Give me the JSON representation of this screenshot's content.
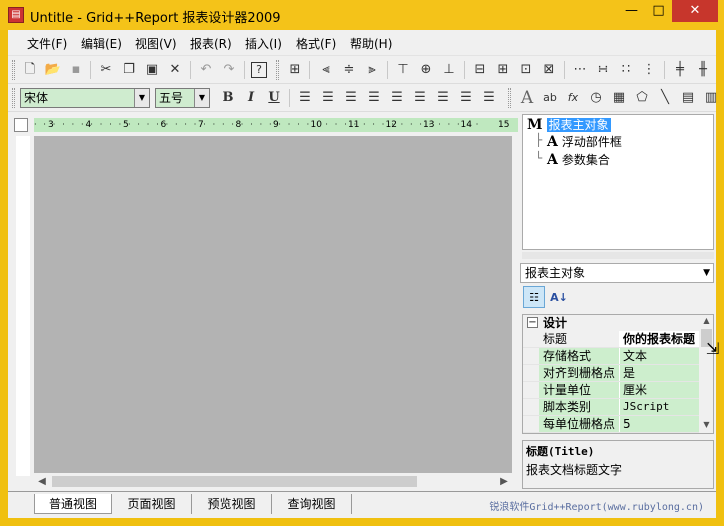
{
  "window": {
    "title": "Untitle - Grid++Report 报表设计器2009",
    "app_icon": "report-designer-icon",
    "minimize": "—",
    "maximize": "□",
    "close": "✕"
  },
  "menu": [
    "文件(F)",
    "编辑(E)",
    "视图(V)",
    "报表(R)",
    "插入(I)",
    "格式(F)",
    "帮助(H)"
  ],
  "toolbar1": {
    "icons": [
      "new-file-icon",
      "open-folder-icon",
      "save-icon",
      "cut-icon",
      "copy-icon",
      "paste-icon",
      "delete-icon",
      "undo-icon",
      "redo-icon",
      "help-icon",
      "grid-icon",
      "align-left-icon",
      "align-center-icon",
      "align-right-icon",
      "align-top-icon",
      "align-middle-icon",
      "align-bottom-icon",
      "same-width-icon",
      "same-height-icon",
      "same-size-icon",
      "space-horizontal-icon",
      "space-equal-icon",
      "space-decrease-icon",
      "space-remove-icon",
      "center-horizontal-icon",
      "center-vertical-icon"
    ]
  },
  "toolbar2": {
    "font_name": "宋体",
    "font_size": "五号",
    "bold": "B",
    "italic": "I",
    "underline": "U",
    "insert_icons": [
      "static-text-icon",
      "field-box-icon",
      "formula-icon",
      "system-var-icon",
      "memo-icon",
      "shape-icon",
      "line-icon",
      "picture-icon",
      "barcode-icon"
    ]
  },
  "ruler": {
    "marks": [
      "3",
      "4",
      "5",
      "6",
      "7",
      "8",
      "9",
      "10",
      "11",
      "12",
      "13",
      "14",
      "15"
    ]
  },
  "view_tabs": [
    "普通视图",
    "页面视图",
    "预览视图",
    "查询视图"
  ],
  "brand": "锐浪软件Grid++Report(www.rubylong.cn)",
  "tree": {
    "root": "报表主对象",
    "root_glyph": "M",
    "children": [
      {
        "glyph": "A",
        "label": "浮动部件框"
      },
      {
        "glyph": "A",
        "label": "参数集合"
      }
    ]
  },
  "object_selector": "报表主对象",
  "property_toolbar": {
    "categorized": "categorized-icon",
    "alphabetical": "sort-az-icon"
  },
  "property_grid": {
    "category": "设计",
    "toggle": "⊟",
    "rows": [
      {
        "name": "标题",
        "value": "你的报表标题"
      },
      {
        "name": "存储格式",
        "value": "文本"
      },
      {
        "name": "对齐到栅格点",
        "value": "是"
      },
      {
        "name": "计量单位",
        "value": "厘米"
      },
      {
        "name": "脚本类别",
        "value": "JScript"
      },
      {
        "name": "每单位栅格点",
        "value": "5"
      }
    ]
  },
  "help": {
    "title": "标题(Title)",
    "description": "报表文档标题文字"
  }
}
